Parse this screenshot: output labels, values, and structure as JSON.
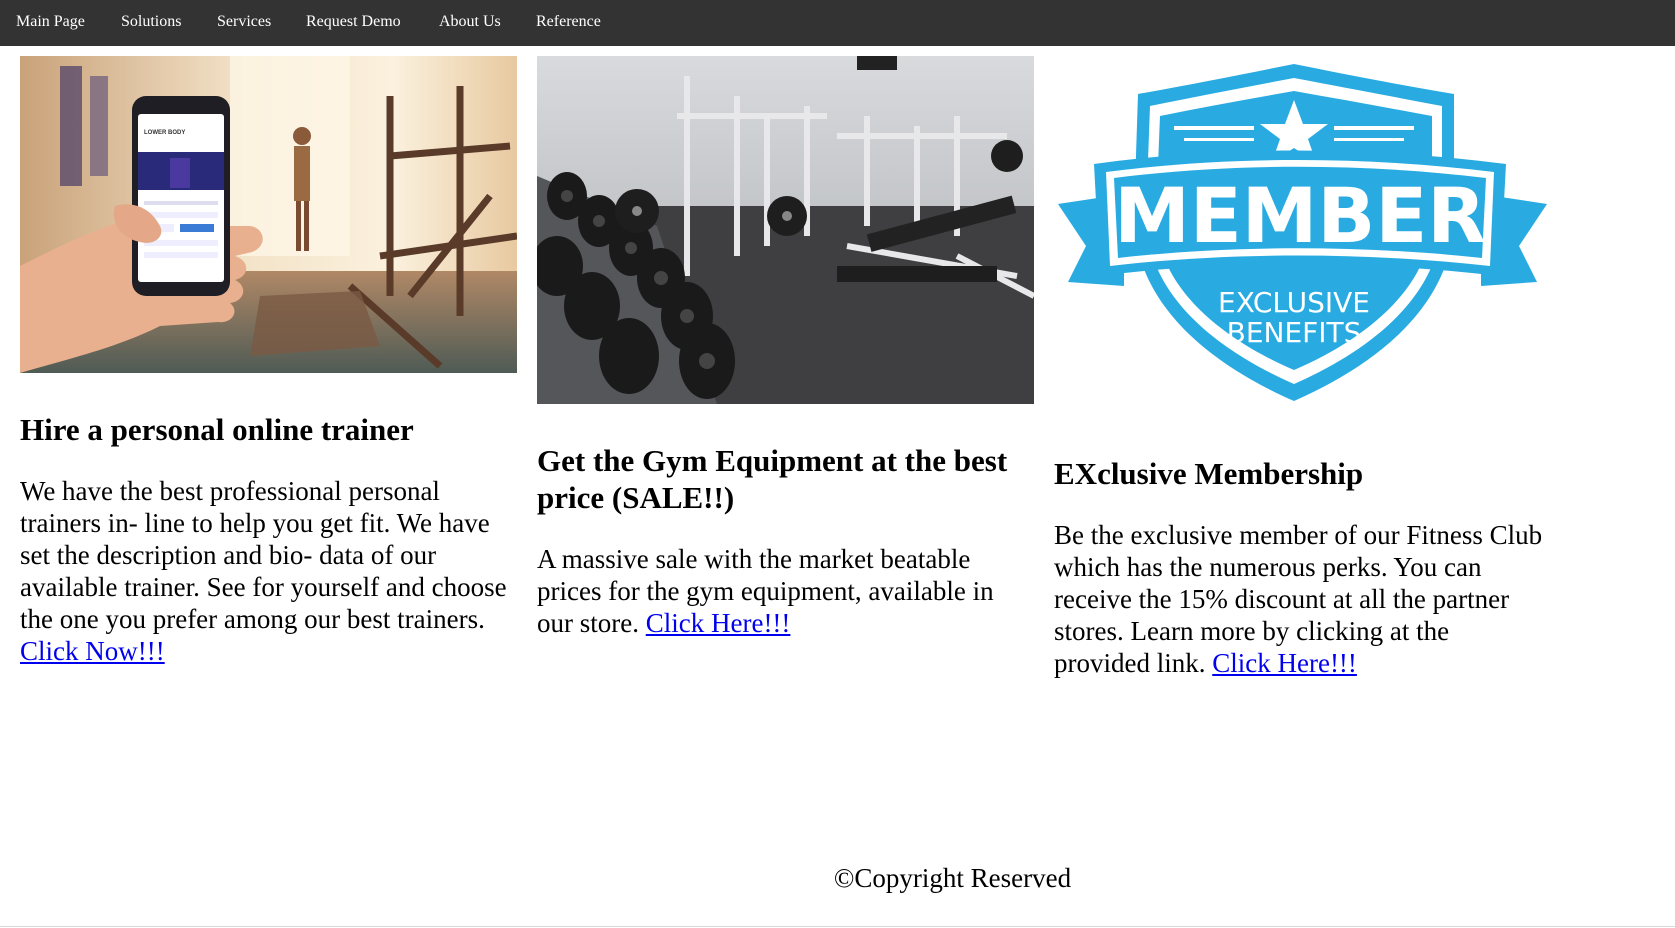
{
  "nav": {
    "items": [
      {
        "label": "Main Page"
      },
      {
        "label": "Solutions"
      },
      {
        "label": "Services"
      },
      {
        "label": "Request Demo"
      },
      {
        "label": "About Us"
      },
      {
        "label": "Reference"
      }
    ]
  },
  "columns": [
    {
      "image_alt": "personal-online-trainer-app-image",
      "phone_screen_title": "LOWER BODY",
      "title": "Hire a personal online trainer",
      "body": "We have the best professional personal trainers in- line to help you get fit. We have set the description and bio- data of our available trainer. See for yourself and choose the one you prefer among our best trainers. ",
      "link": "Click Now!!!"
    },
    {
      "image_alt": "gym-equipment-image",
      "title": "Get the Gym Equipment at the best price (SALE!!)",
      "body": "A massive sale with the market beatable prices for the gym equipment, available in our store. ",
      "link": "Click Here!!!"
    },
    {
      "image_alt": "member-exclusive-benefits-badge",
      "badge_main": "MEMBER",
      "badge_line1": "EXCLUSIVE",
      "badge_line2": "BENEFITS",
      "title": "EXclusive Membership",
      "body": "Be the exclusive member of our Fitness Club which has the numerous perks. You can receive the 15% discount at all the partner stores. Learn more by clicking at the provided link. ",
      "link": "Click Here!!!"
    }
  ],
  "footer": {
    "text": "©Copyright Reserved"
  },
  "colors": {
    "nav_bg": "#333333",
    "nav_text": "#ffffff",
    "link": "#0000ee",
    "badge_blue": "#29abe2"
  }
}
